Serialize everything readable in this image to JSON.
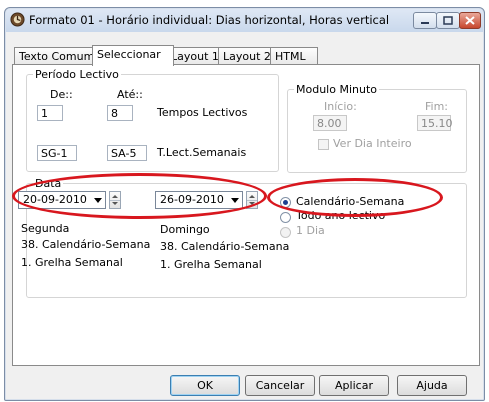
{
  "window": {
    "title": "Formato 01 - Horário individual: Dias horizontal, Horas vertical"
  },
  "tabs": [
    {
      "label": "Texto Comum",
      "active": false
    },
    {
      "label": "Seleccionar",
      "active": true
    },
    {
      "label": "Layout 1",
      "active": false
    },
    {
      "label": "Layout 2",
      "active": false
    },
    {
      "label": "HTML",
      "active": false
    }
  ],
  "periodo": {
    "legend": "Período Lectivo",
    "de_label": "De::",
    "ate_label": "Até::",
    "de_value": "1",
    "ate_value": "8",
    "tempos_label": "Tempos Lectivos",
    "sg_value": "SG-1",
    "sa_value": "SA-5",
    "semanais_label": "T.Lect.Semanais"
  },
  "modulo": {
    "legend": "Modulo Minuto",
    "inicio_label": "Início:",
    "fim_label": "Fim:",
    "inicio_value": "8.00",
    "fim_value": "15.10",
    "ver_dia_label": "Ver Dia Inteiro"
  },
  "data": {
    "legend": "Data",
    "from_date": "20-09-2010",
    "to_date": "26-09-2010",
    "from_day": "Segunda",
    "from_week": "38. Calendário-Semana",
    "from_grid": "1. Grelha Semanal",
    "to_day": "Domingo",
    "to_week": "38. Calendário-Semana",
    "to_grid": "1. Grelha Semanal",
    "options": [
      {
        "label": "Calendário-Semana",
        "selected": true,
        "enabled": true
      },
      {
        "label": "Todo ano lectivo",
        "selected": false,
        "enabled": true
      },
      {
        "label": "1 Dia",
        "selected": false,
        "enabled": false
      }
    ]
  },
  "buttons": {
    "ok": "OK",
    "cancel": "Cancelar",
    "apply": "Aplicar",
    "help": "Ajuda"
  },
  "colors": {
    "highlight_ellipse": "#d8171e",
    "selected_radio": "#1d3f8f"
  }
}
